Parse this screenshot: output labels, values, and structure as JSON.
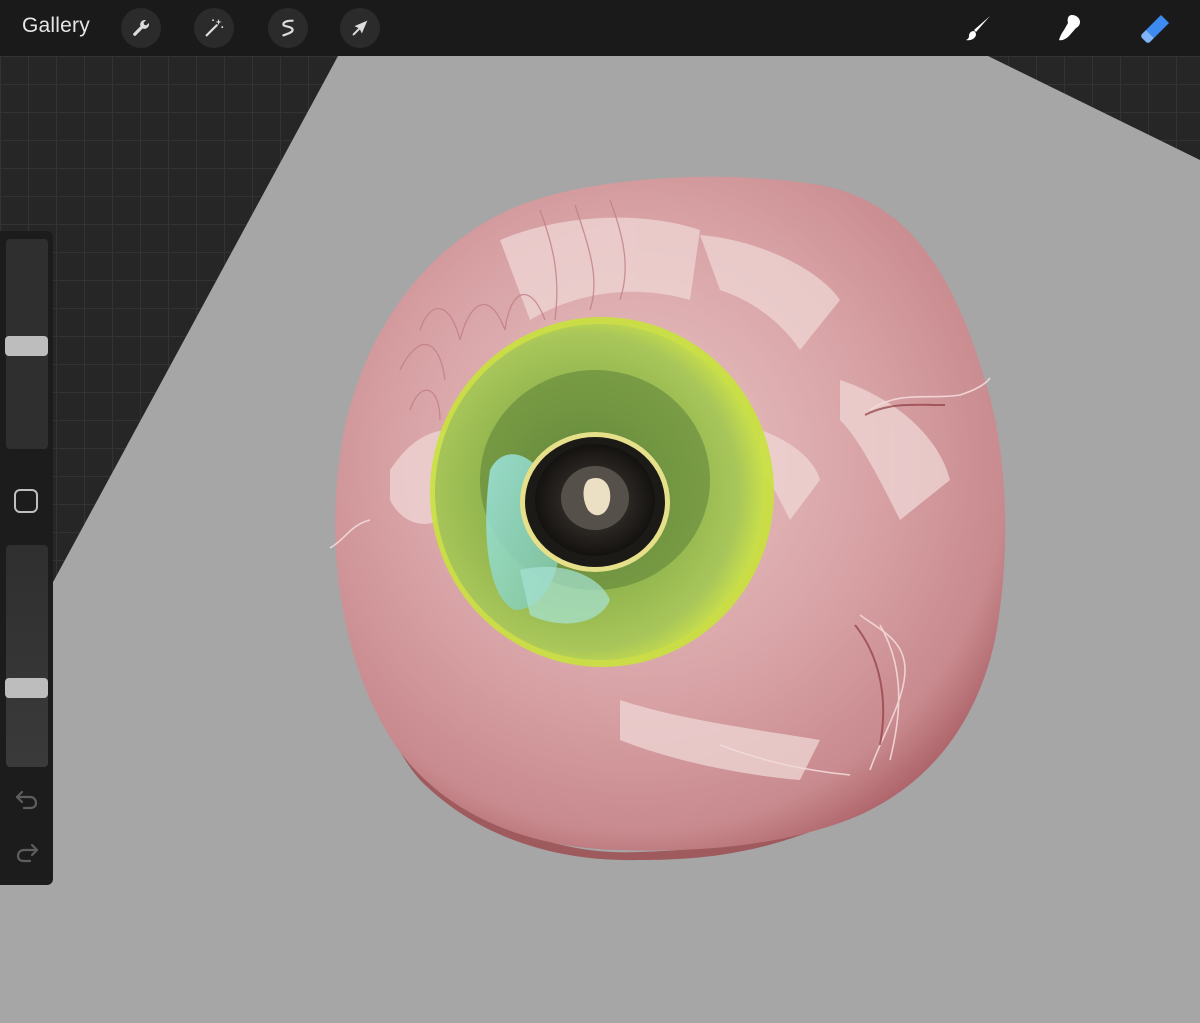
{
  "toolbar": {
    "gallery_label": "Gallery",
    "left_tools": [
      "wrench-icon",
      "magic-wand-icon",
      "selection-icon",
      "transform-arrow-icon"
    ],
    "right_tools": [
      "brush-icon",
      "smudge-icon",
      "eraser-icon"
    ],
    "active_tool": "eraser-icon"
  },
  "sidebar": {
    "brush_size_level": 0.49,
    "brush_opacity_level": 0.34,
    "modify_button": "square-icon",
    "undo": "undo-icon",
    "redo": "redo-icon"
  },
  "colors": {
    "accent": "#3d8bf0",
    "toolbar_bg": "#1a1a1a",
    "canvas_bg": "#a6a6a6",
    "sclera": "#d9a4a6",
    "iris": "#a3c452",
    "pupil": "#1e1a17"
  }
}
